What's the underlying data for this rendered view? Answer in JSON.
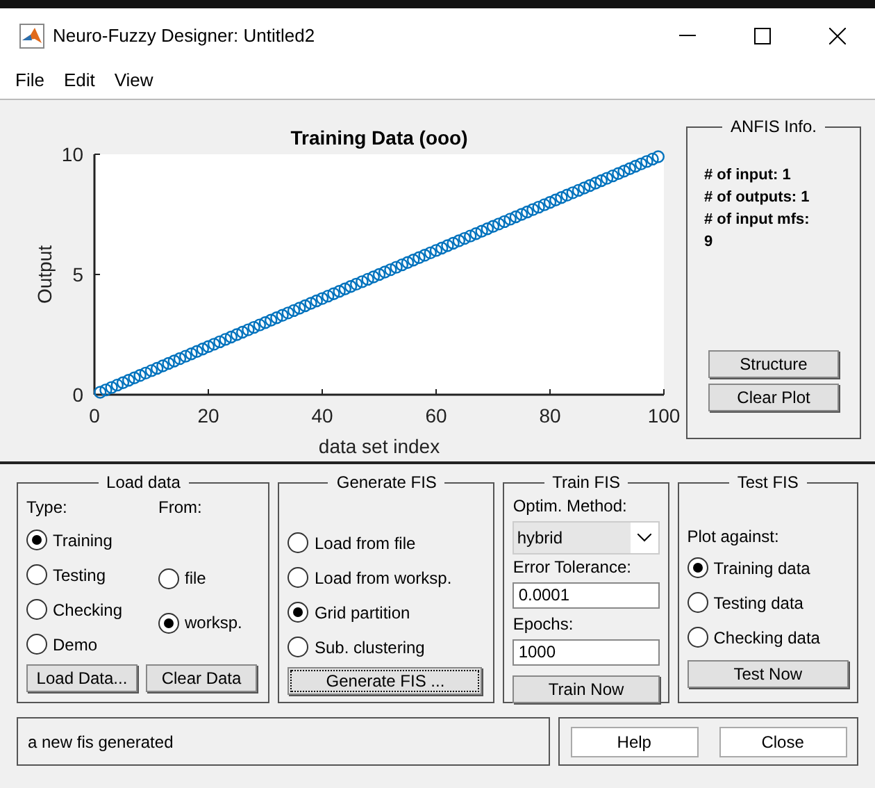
{
  "window": {
    "title": "Neuro-Fuzzy Designer: Untitled2"
  },
  "menu": [
    {
      "label": "File"
    },
    {
      "label": "Edit"
    },
    {
      "label": "View"
    }
  ],
  "plot": {
    "chart_data": {
      "type": "scatter",
      "title": "Training Data (ooo)",
      "xlabel": "data set index",
      "ylabel": "Output",
      "xlim": [
        0,
        100
      ],
      "ylim": [
        0,
        10
      ],
      "xticks": [
        0,
        20,
        40,
        60,
        80,
        100
      ],
      "yticks": [
        0,
        5,
        10
      ],
      "x": [
        1,
        2,
        3,
        4,
        5,
        6,
        7,
        8,
        9,
        10,
        11,
        12,
        13,
        14,
        15,
        16,
        17,
        18,
        19,
        20,
        21,
        22,
        23,
        24,
        25,
        26,
        27,
        28,
        29,
        30,
        31,
        32,
        33,
        34,
        35,
        36,
        37,
        38,
        39,
        40,
        41,
        42,
        43,
        44,
        45,
        46,
        47,
        48,
        49,
        50,
        51,
        52,
        53,
        54,
        55,
        56,
        57,
        58,
        59,
        60,
        61,
        62,
        63,
        64,
        65,
        66,
        67,
        68,
        69,
        70,
        71,
        72,
        73,
        74,
        75,
        76,
        77,
        78,
        79,
        80,
        81,
        82,
        83,
        84,
        85,
        86,
        87,
        88,
        89,
        90,
        91,
        92,
        93,
        94,
        95,
        96,
        97,
        98,
        99
      ],
      "series": [
        {
          "color": "#0072bd",
          "values": [
            0.1,
            0.2,
            0.3,
            0.4,
            0.5,
            0.6,
            0.7,
            0.8,
            0.9,
            1.0,
            1.1,
            1.2,
            1.3,
            1.4,
            1.5,
            1.6,
            1.7,
            1.8,
            1.9,
            2.0,
            2.1,
            2.2,
            2.3,
            2.4,
            2.5,
            2.6,
            2.7,
            2.8,
            2.9,
            3.0,
            3.1,
            3.2,
            3.3,
            3.4,
            3.5,
            3.6,
            3.7,
            3.8,
            3.9,
            4.0,
            4.1,
            4.2,
            4.3,
            4.4,
            4.5,
            4.6,
            4.7,
            4.8,
            4.9,
            5.0,
            5.1,
            5.2,
            5.3,
            5.4,
            5.5,
            5.6,
            5.7,
            5.8,
            5.9,
            6.0,
            6.1,
            6.2,
            6.3,
            6.4,
            6.5,
            6.6,
            6.7,
            6.8,
            6.9,
            7.0,
            7.1,
            7.2,
            7.3,
            7.4,
            7.5,
            7.6,
            7.7,
            7.8,
            7.9,
            8.0,
            8.1,
            8.2,
            8.3,
            8.4,
            8.5,
            8.6,
            8.7,
            8.8,
            8.9,
            9.0,
            9.1,
            9.2,
            9.3,
            9.4,
            9.5,
            9.6,
            9.7,
            9.8,
            9.9
          ]
        }
      ]
    }
  },
  "anfis_info": {
    "title": "ANFIS Info.",
    "lines": [
      "# of input: 1",
      "# of outputs: 1",
      "# of input mfs:",
      "9"
    ],
    "buttons": [
      "Structure",
      "Clear Plot"
    ]
  },
  "load_data": {
    "title": "Load data",
    "type_label": "Type:",
    "from_label": "From:",
    "types": [
      {
        "label": "Training",
        "selected": true
      },
      {
        "label": "Testing",
        "selected": false
      },
      {
        "label": "Checking",
        "selected": false
      },
      {
        "label": "Demo",
        "selected": false
      }
    ],
    "sources": [
      {
        "label": "file",
        "selected": false
      },
      {
        "label": "worksp.",
        "selected": true
      }
    ],
    "buttons": [
      "Load Data...",
      "Clear Data"
    ]
  },
  "generate_fis": {
    "title": "Generate FIS",
    "options": [
      {
        "label": "Load from file",
        "selected": false
      },
      {
        "label": "Load from worksp.",
        "selected": false
      },
      {
        "label": "Grid partition",
        "selected": true
      },
      {
        "label": "Sub. clustering",
        "selected": false
      }
    ],
    "button": {
      "label": "Generate FIS ...",
      "focused": true
    }
  },
  "train_fis": {
    "title": "Train FIS",
    "method_label": "Optim. Method:",
    "method": "hybrid",
    "tolerance_label": "Error Tolerance:",
    "tolerance": "0.0001",
    "epochs_label": "Epochs:",
    "epochs": "1000",
    "button": "Train Now"
  },
  "test_fis": {
    "title": "Test FIS",
    "plot_against_label": "Plot against:",
    "options": [
      {
        "label": "Training data",
        "selected": true
      },
      {
        "label": "Testing data",
        "selected": false
      },
      {
        "label": "Checking data",
        "selected": false
      }
    ],
    "button": "Test Now"
  },
  "status": "a new fis generated",
  "buttons": [
    "Help",
    "Close"
  ]
}
